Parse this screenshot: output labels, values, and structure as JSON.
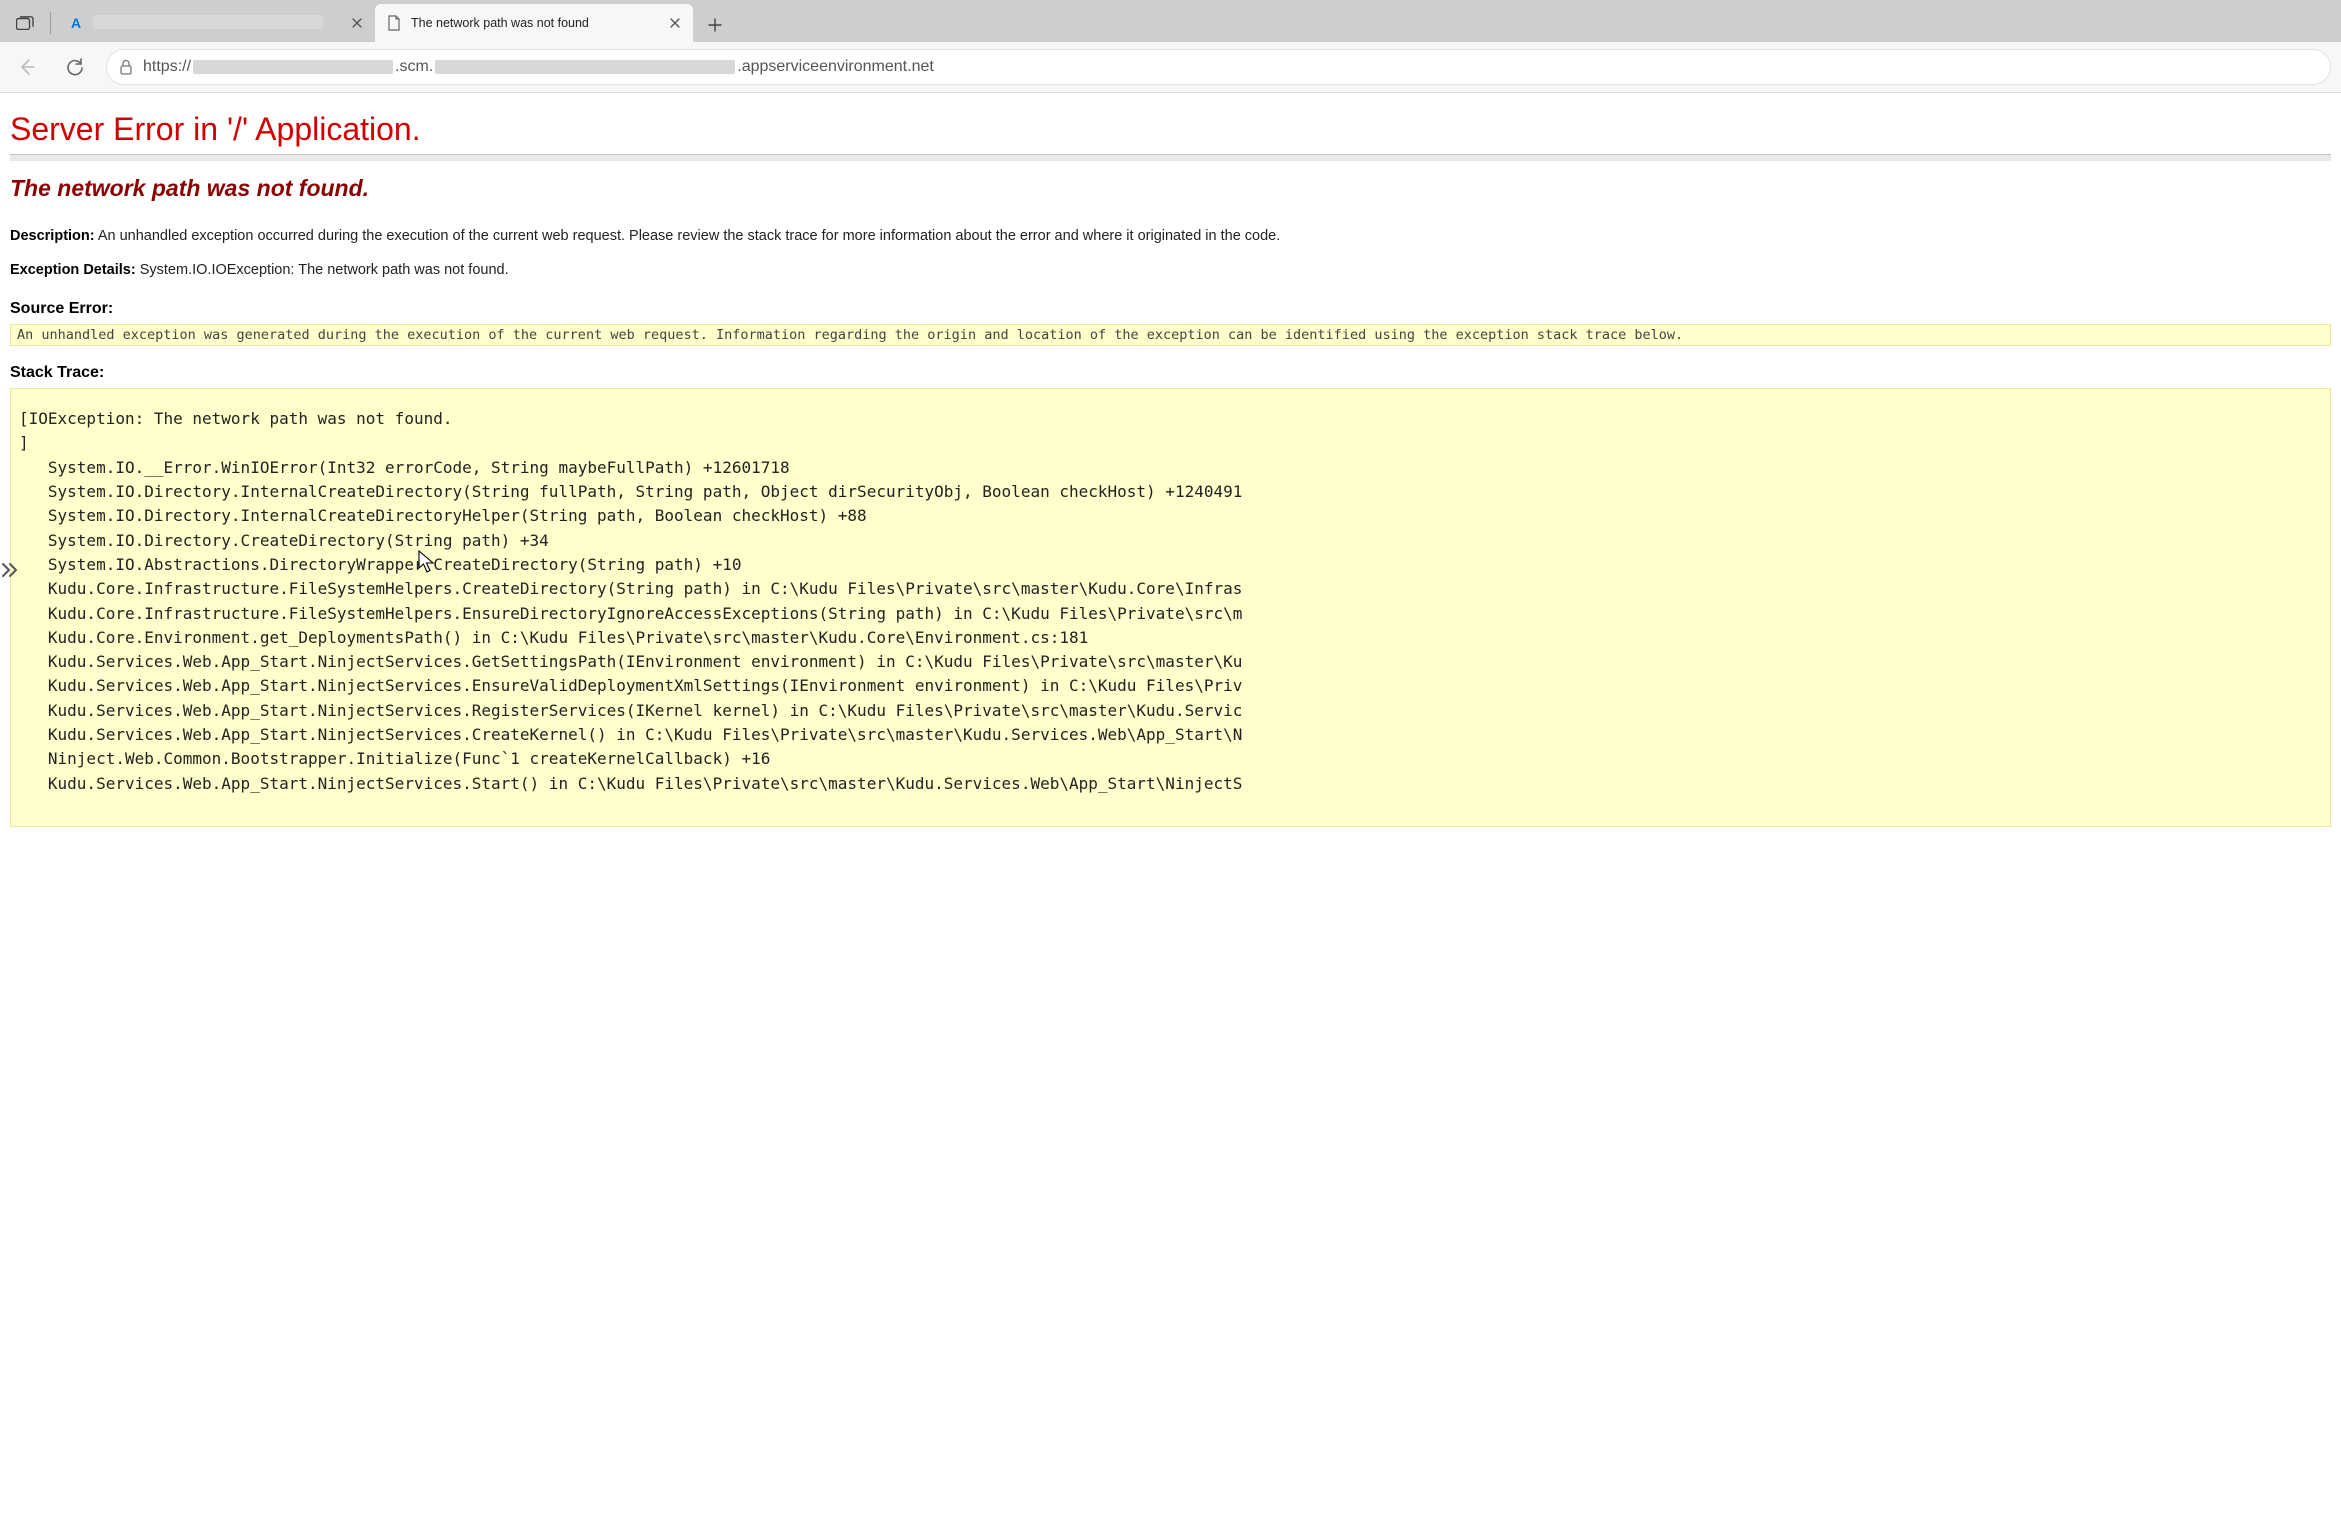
{
  "browser": {
    "tabs": [
      {
        "title": "",
        "active": false,
        "favicon": "azure"
      },
      {
        "title": "The network path was not found",
        "active": true,
        "favicon": "page"
      }
    ],
    "url_prefix": "https://",
    "url_mid1": ".scm.",
    "url_suffix": ".appserviceenvironment.net"
  },
  "error": {
    "title": "Server Error in '/' Application.",
    "subtitle": "The network path was not found.",
    "desc_label": "Description:",
    "desc_text": "An unhandled exception occurred during the execution of the current web request. Please review the stack trace for more information about the error and where it originated in the code.",
    "ex_label": "Exception Details:",
    "ex_text": "System.IO.IOException: The network path was not found.",
    "source_label": "Source Error:",
    "source_box": "An unhandled exception was generated during the execution of the current web request. Information regarding the origin and location of the exception can be identified using the exception stack trace below.",
    "stack_label": "Stack Trace:",
    "stack_trace": "[IOException: The network path was not found.\n]\n   System.IO.__Error.WinIOError(Int32 errorCode, String maybeFullPath) +12601718\n   System.IO.Directory.InternalCreateDirectory(String fullPath, String path, Object dirSecurityObj, Boolean checkHost) +1240491\n   System.IO.Directory.InternalCreateDirectoryHelper(String path, Boolean checkHost) +88\n   System.IO.Directory.CreateDirectory(String path) +34\n   System.IO.Abstractions.DirectoryWrapper.CreateDirectory(String path) +10\n   Kudu.Core.Infrastructure.FileSystemHelpers.CreateDirectory(String path) in C:\\Kudu Files\\Private\\src\\master\\Kudu.Core\\Infras\n   Kudu.Core.Infrastructure.FileSystemHelpers.EnsureDirectoryIgnoreAccessExceptions(String path) in C:\\Kudu Files\\Private\\src\\m\n   Kudu.Core.Environment.get_DeploymentsPath() in C:\\Kudu Files\\Private\\src\\master\\Kudu.Core\\Environment.cs:181\n   Kudu.Services.Web.App_Start.NinjectServices.GetSettingsPath(IEnvironment environment) in C:\\Kudu Files\\Private\\src\\master\\Ku\n   Kudu.Services.Web.App_Start.NinjectServices.EnsureValidDeploymentXmlSettings(IEnvironment environment) in C:\\Kudu Files\\Priv\n   Kudu.Services.Web.App_Start.NinjectServices.RegisterServices(IKernel kernel) in C:\\Kudu Files\\Private\\src\\master\\Kudu.Servic\n   Kudu.Services.Web.App_Start.NinjectServices.CreateKernel() in C:\\Kudu Files\\Private\\src\\master\\Kudu.Services.Web\\App_Start\\N\n   Ninject.Web.Common.Bootstrapper.Initialize(Func`1 createKernelCallback) +16\n   Kudu.Services.Web.App_Start.NinjectServices.Start() in C:\\Kudu Files\\Private\\src\\master\\Kudu.Services.Web\\App_Start\\NinjectS"
  }
}
